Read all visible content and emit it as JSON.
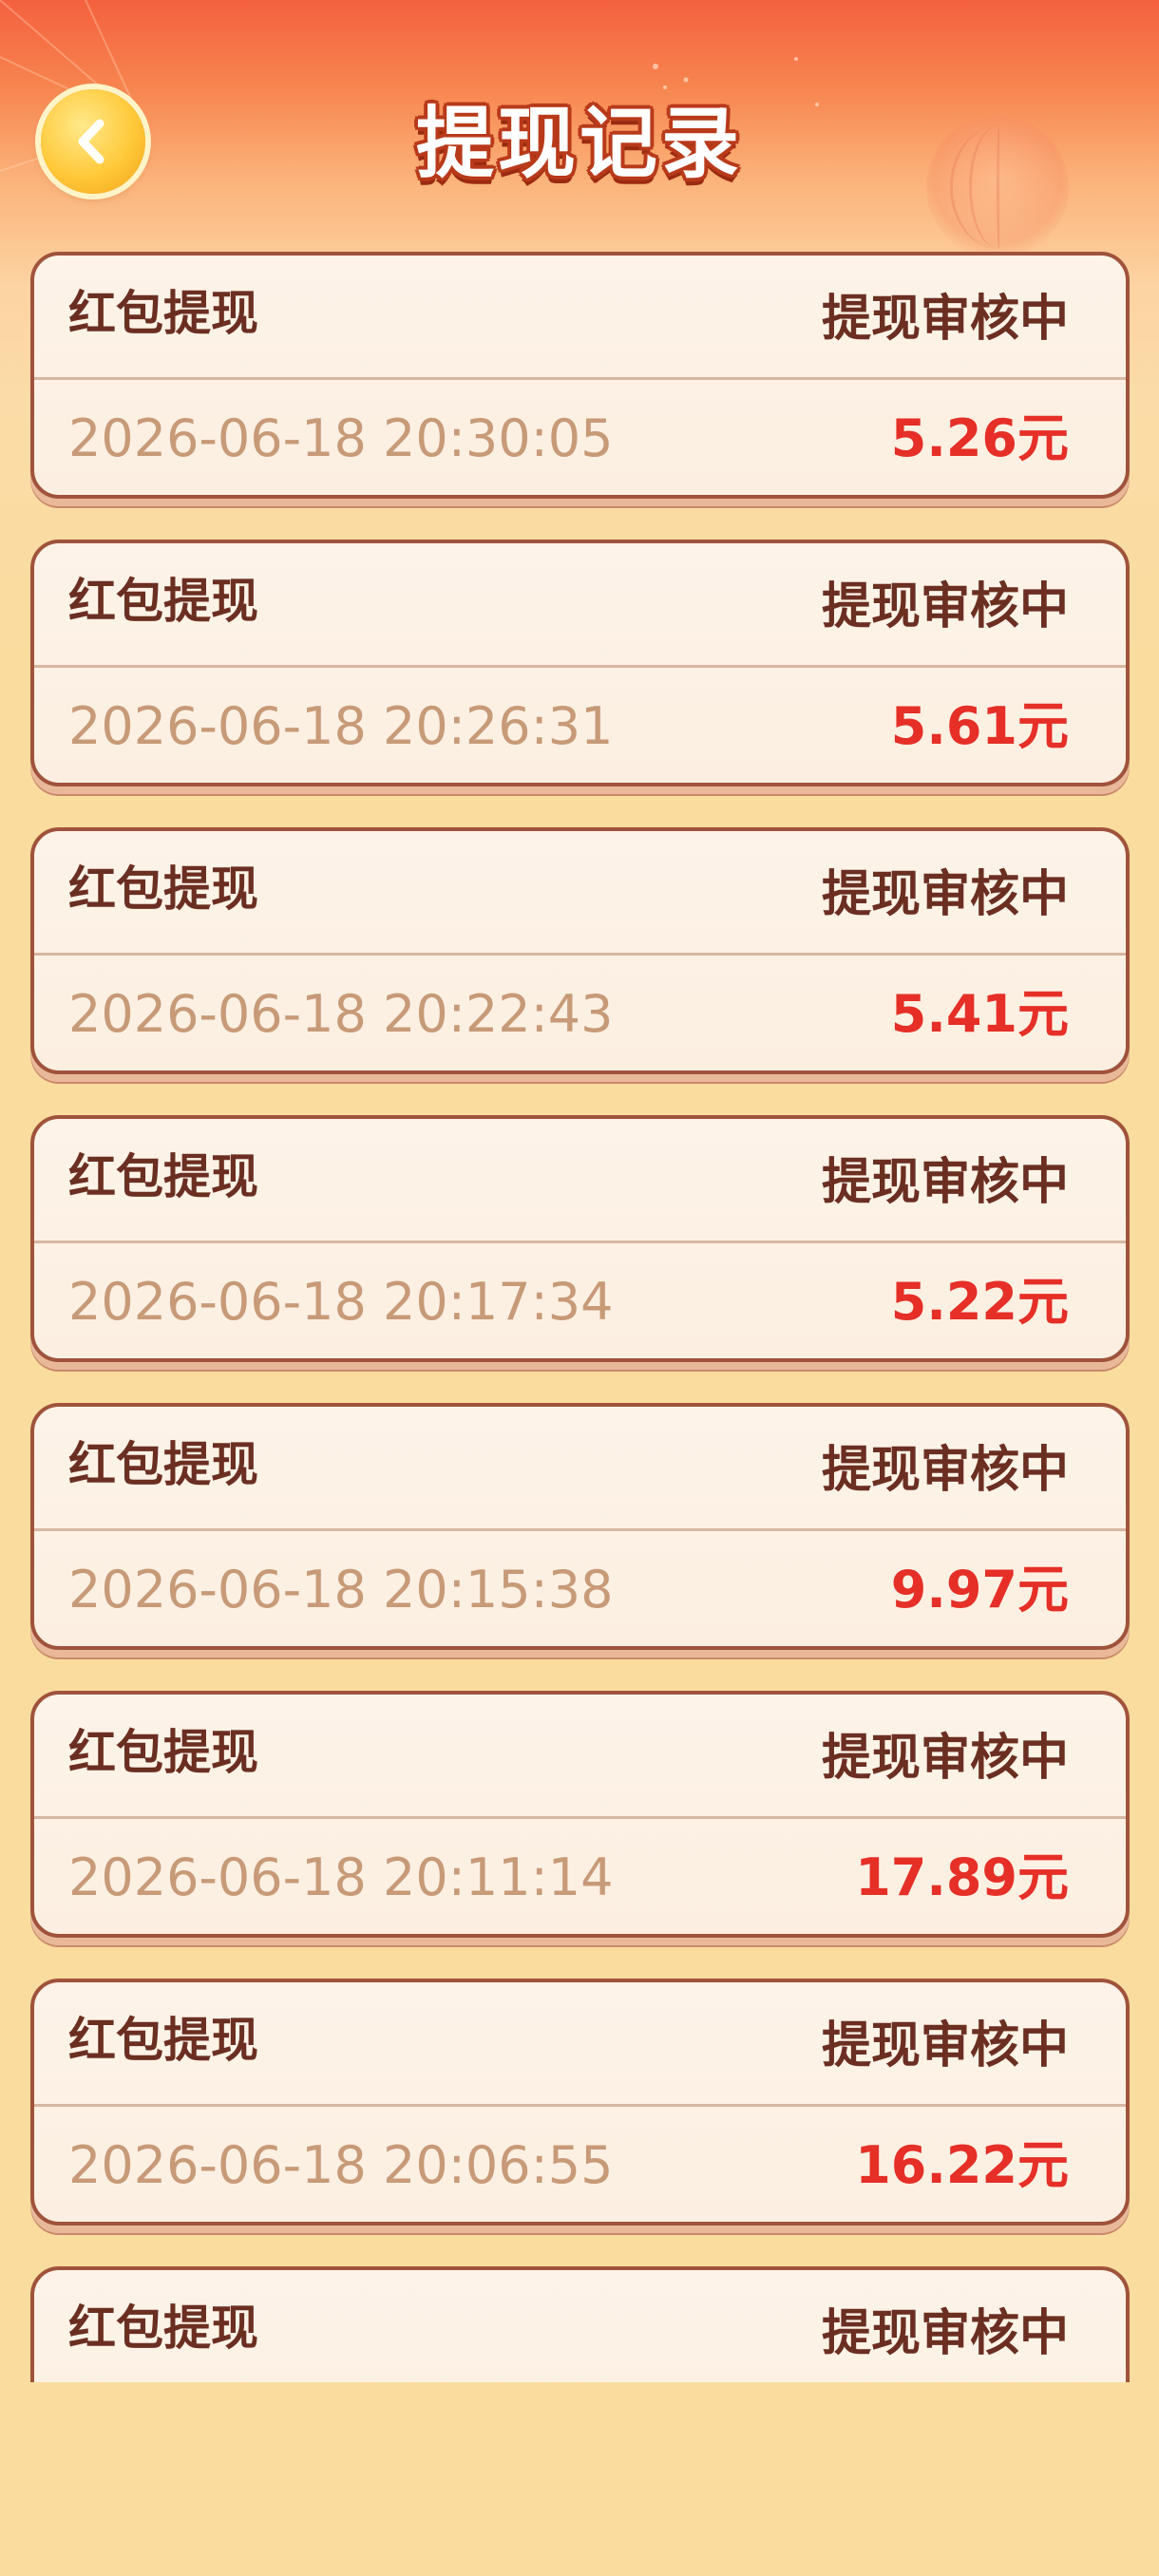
{
  "header": {
    "title": "提现记录",
    "back_icon": "chevron-left-icon"
  },
  "colors": {
    "header_red": "#f4603f",
    "page_background": "#fadc9f",
    "card_background": "#fdf3e8",
    "card_border": "#a0533c",
    "label_text": "#6b2f22",
    "time_text": "#c79a78",
    "amount_red": "#e52f27",
    "back_button_gold": "#ffc93a"
  },
  "records": [
    {
      "type": "红包提现",
      "status": "提现审核中",
      "time": "2026-06-18 20:30:05",
      "amount": "5.26元"
    },
    {
      "type": "红包提现",
      "status": "提现审核中",
      "time": "2026-06-18 20:26:31",
      "amount": "5.61元"
    },
    {
      "type": "红包提现",
      "status": "提现审核中",
      "time": "2026-06-18 20:22:43",
      "amount": "5.41元"
    },
    {
      "type": "红包提现",
      "status": "提现审核中",
      "time": "2026-06-18 20:17:34",
      "amount": "5.22元"
    },
    {
      "type": "红包提现",
      "status": "提现审核中",
      "time": "2026-06-18 20:15:38",
      "amount": "9.97元"
    },
    {
      "type": "红包提现",
      "status": "提现审核中",
      "time": "2026-06-18 20:11:14",
      "amount": "17.89元"
    },
    {
      "type": "红包提现",
      "status": "提现审核中",
      "time": "2026-06-18 20:06:55",
      "amount": "16.22元"
    },
    {
      "type": "红包提现",
      "status": "提现审核中"
    }
  ]
}
